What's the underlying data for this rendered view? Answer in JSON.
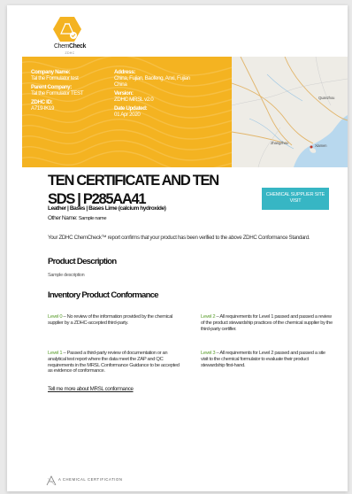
{
  "logo": {
    "brand_bold": "Chem",
    "brand_rest": "Check",
    "tagline": "ZDHC"
  },
  "info": {
    "company_name_label": "Company Name:",
    "company_name": "Tal the Formulator test",
    "parent_company_label": "Parent Company:",
    "parent_company": "Tal the Formulator TEST",
    "zdhc_id_label": "ZDHC ID:",
    "zdhc_id": "A719-IK19",
    "address_label": "Address:",
    "address": "China, Fujian, Baofeng, Anxi, Fujian China",
    "version_label": "Version:",
    "version": "ZDHC MRSL v2.0",
    "date_updated_label": "Date Updated:",
    "date_updated": "01 Apr 2020"
  },
  "map": {
    "labels": [
      "Zhangzhou",
      "Xiamen",
      "Quanzhou"
    ]
  },
  "title": "TEN CERTIFICATE AND TEN SDS | P285AA41",
  "subtitle": "Leather | Bases | Bases Lime (calcium hydroxide)",
  "other_name_label": "Other Name:",
  "other_name": "Sample name",
  "visit_button": "CHEMICAL SUPPLIER SITE VISIT",
  "intro": "Your ZDHC ChemCheck™ report confirms that your product has been verified to the above ZDHC Conformance Standard.",
  "product_description_heading": "Product Description",
  "product_description": "Sample description",
  "inventory_heading": "Inventory Product Conformance",
  "levels": [
    {
      "name": "Level 0",
      "text": " – No review of the information provided by the chemical supplier by a ZDHC-accepted third-party."
    },
    {
      "name": "Level 1",
      "text": " – Passed a third-party review of documentation or an analytical test report where the data meet the ZAP and QC requirements in the MRSL Conformance Guidance to be accepted as evidence of conformance."
    },
    {
      "name": "Level 2",
      "text": " – All requirements for Level 1 passed and passed a review of the product stewardship practices of the chemical supplier by the third-party certifier."
    },
    {
      "name": "Level 3",
      "text": " – All requirements for Level 2 passed and passed a site visit to the chemical formulator to evaluate their product stewardship first-hand."
    }
  ],
  "more_link": "Tell me more about MRSL conformance",
  "footer": "A CHEMICAL CERTIFICATION",
  "colors": {
    "accent_yellow": "#f4b321",
    "button_teal": "#37b6c4",
    "level_green": "#5a9c2c"
  }
}
